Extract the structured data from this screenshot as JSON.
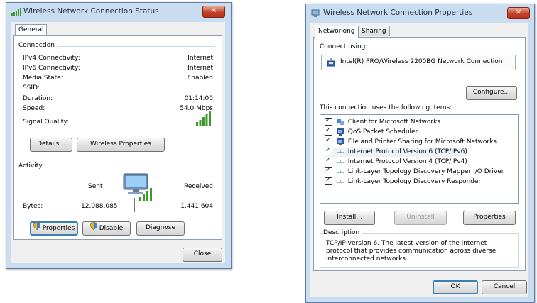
{
  "status_window": {
    "title": "Wireless Network Connection Status",
    "close_label": "✕",
    "tab": "General",
    "connection_label": "Connection",
    "rows": [
      {
        "label": "IPv4 Connectivity:",
        "value": "Internet"
      },
      {
        "label": "IPv6 Connectivity:",
        "value": "Internet"
      },
      {
        "label": "Media State:",
        "value": "Enabled"
      },
      {
        "label": "SSID:",
        "value": ""
      },
      {
        "label": "Duration:",
        "value": "01:14:00"
      },
      {
        "label": "Speed:",
        "value": "54.0 Mbps"
      }
    ],
    "signal_label": "Signal Quality:",
    "details_button": "Details...",
    "wireless_props_button": "Wireless Properties",
    "activity_label": "Activity",
    "sent_label": "Sent",
    "received_label": "Received",
    "bytes_label": "Bytes:",
    "bytes_sent": "12.088.085",
    "bytes_received": "1.441.604",
    "properties_button": "Properties",
    "disable_button": "Disable",
    "diagnose_button": "Diagnose",
    "close_button": "Close"
  },
  "properties_window": {
    "title": "Wireless Network Connection Properties",
    "close_label": "✕",
    "tabs": [
      "Networking",
      "Sharing"
    ],
    "connect_using_label": "Connect using:",
    "adapter_name": "Intel(R) PRO/Wireless 2200BG Network Connection",
    "configure_button": "Configure...",
    "items_label": "This connection uses the following items:",
    "items": [
      {
        "label": "Client for Microsoft Networks",
        "checked": true,
        "icon": "network-client-icon"
      },
      {
        "label": "QoS Packet Scheduler",
        "checked": true,
        "icon": "service-icon"
      },
      {
        "label": "File and Printer Sharing for Microsoft Networks",
        "checked": true,
        "icon": "service-icon"
      },
      {
        "label": "Internet Protocol Version 6 (TCP/IPv6)",
        "checked": true,
        "icon": "protocol-icon"
      },
      {
        "label": "Internet Protocol Version 4 (TCP/IPv4)",
        "checked": true,
        "icon": "protocol-icon"
      },
      {
        "label": "Link-Layer Topology Discovery Mapper I/O Driver",
        "checked": true,
        "icon": "protocol-icon"
      },
      {
        "label": "Link-Layer Topology Discovery Responder",
        "checked": true,
        "icon": "protocol-icon"
      }
    ],
    "install_button": "Install...",
    "uninstall_button": "Uninstall",
    "properties_button": "Properties",
    "description_label": "Description",
    "description_text": "TCP/IP version 6. The latest version of the internet protocol that provides communication across diverse interconnected networks.",
    "ok_button": "OK",
    "cancel_button": "Cancel"
  },
  "colors": {
    "frame": "#c9dcf0",
    "close": "#c4432a",
    "signal": "#3b9a2a"
  }
}
